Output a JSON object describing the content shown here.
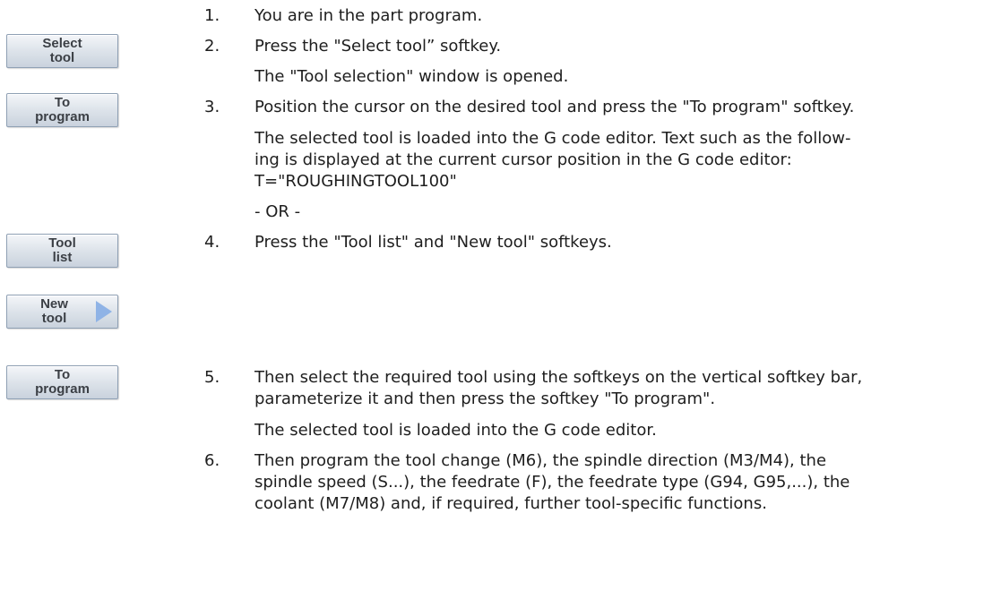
{
  "softkeys": [
    {
      "label": "Select\ntool"
    },
    {
      "label": "To\nprogram"
    },
    {
      "label": "Tool\nlist"
    },
    {
      "label": "New\ntool"
    },
    {
      "label": "To\nprogram"
    }
  ],
  "steps": [
    {
      "number": "1.",
      "lines": [
        "You are in the part program."
      ]
    },
    {
      "number": "2.",
      "lines": [
        "Press the \"Select tool” softkey.",
        "The \"Tool selection\" window is opened."
      ]
    },
    {
      "number": "3.",
      "lines": [
        "Position the cursor on the desired tool and press the \"To program\" softkey.",
        "The selected tool is loaded into the G code editor. Text such as the follow-",
        "ing is displayed at the current cursor position in the G code editor:",
        "T=\"ROUGHINGTOOL100\"",
        "- OR -"
      ]
    },
    {
      "number": "4.",
      "lines": [
        "Press the \"Tool list\" and \"New tool\" softkeys."
      ]
    },
    {
      "number": "5.",
      "lines": [
        "Then select the required tool using the softkeys on the vertical softkey bar,",
        "parameterize it and then press the softkey \"To program\".",
        "The selected tool is loaded into the G code editor."
      ]
    },
    {
      "number": "6.",
      "lines": [
        "Then program the tool change (M6), the spindle direction (M3/M4), the",
        "spindle speed (S...), the feedrate (F), the feedrate type (G94, G95,...), the",
        "coolant (M7/M8) and, if required, further tool-specific functions."
      ]
    }
  ]
}
